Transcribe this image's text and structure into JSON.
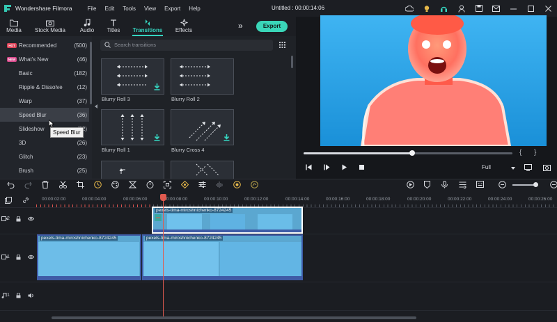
{
  "app": {
    "name": "Wondershare Filmora",
    "menu": [
      "File",
      "Edit",
      "Tools",
      "View",
      "Export",
      "Help"
    ],
    "doc_title": "Untitled : 00:00:14:06",
    "title_icons": [
      "cloud-icon",
      "bulb-icon",
      "headset-icon",
      "account-icon",
      "save-icon",
      "mail-icon",
      "minimize-icon",
      "restore-icon",
      "close-icon"
    ]
  },
  "tabs": [
    {
      "label": "Media",
      "icon": "folder-icon"
    },
    {
      "label": "Stock Media",
      "icon": "camera-icon"
    },
    {
      "label": "Audio",
      "icon": "music-note-icon"
    },
    {
      "label": "Titles",
      "icon": "text-t-icon"
    },
    {
      "label": "Transitions",
      "icon": "transition-icon",
      "active": true
    },
    {
      "label": "Effects",
      "icon": "sparkle-icon"
    }
  ],
  "export_label": "Export",
  "sidebar": {
    "items": [
      {
        "label": "Recommended",
        "count": "(500)",
        "badge": "HOT"
      },
      {
        "label": "What's New",
        "count": "(46)",
        "badge": "NEW"
      },
      {
        "label": "Basic",
        "count": "(182)"
      },
      {
        "label": "Ripple & Dissolve",
        "count": "(12)"
      },
      {
        "label": "Warp",
        "count": "(37)"
      },
      {
        "label": "Speed Blur",
        "count": "(36)",
        "selected": true
      },
      {
        "label": "Slideshow",
        "count": "(22)"
      },
      {
        "label": "3D",
        "count": "(26)"
      },
      {
        "label": "Glitch",
        "count": "(23)"
      },
      {
        "label": "Brush",
        "count": "(25)"
      }
    ],
    "tooltip": "Speed Blur"
  },
  "search": {
    "placeholder": "Search transitions"
  },
  "transitions": [
    {
      "label": "Blurry Roll 3",
      "downloadable": true
    },
    {
      "label": "Blurry Roll 2",
      "downloadable": false
    },
    {
      "label": "Blurry Roll 1",
      "downloadable": true
    },
    {
      "label": "Blurry Cross 4",
      "downloadable": true
    },
    {
      "label": "",
      "downloadable": false
    },
    {
      "label": "",
      "downloadable": false
    }
  ],
  "preview": {
    "progress": 0.52,
    "quality": "Full",
    "controls": [
      "previous-frame-icon",
      "play-pause-icon",
      "play-icon",
      "stop-icon"
    ],
    "right_controls": [
      "monitor-icon",
      "snapshot-icon"
    ]
  },
  "toolbar": {
    "left_tools": [
      "undo-icon",
      "redo-icon",
      "delete-icon",
      "cut-icon",
      "crop-icon",
      "speed-icon",
      "color-icon",
      "duration-icon",
      "stabilize-icon",
      "keyframe-icon",
      "adjust-icon",
      "audio-mix-icon",
      "green-screen-icon",
      "speed-ramp-icon"
    ],
    "right_tools": [
      "render-icon",
      "marker-icon",
      "voiceover-icon",
      "audio-mixer-icon",
      "subtitle-icon",
      "zoom-out-icon",
      "zoom-in-icon"
    ],
    "zoom_level": 0.92
  },
  "timeline": {
    "ruler": [
      "00:00:02:00",
      "00:00:04:00",
      "00:00:06:00",
      "00:00:08:00",
      "00:00:10:00",
      "00:00:12:00",
      "00:00:14:00",
      "00:00:16:00",
      "00:00:18:00",
      "00:00:20:00",
      "00:00:22:00",
      "00:00:24:00",
      "00:00:26:00"
    ],
    "tracks": [
      {
        "id": "2",
        "clips": [
          {
            "name": "pexels-tima-miroshnichenko-8724245",
            "selected": true
          }
        ]
      },
      {
        "id": "1",
        "clips": [
          {
            "name": "pexels-tima-miroshnichenko-8724245"
          },
          {
            "name": "pexels-tima-miroshnichenko-8724245"
          }
        ]
      },
      {
        "id": "1",
        "type": "audio",
        "clips": []
      }
    ]
  },
  "colors": {
    "accent": "#35d5c0",
    "playhead": "#e05a4f",
    "clip_blue": "#5ba7d0",
    "selected_clip_border": "#ffffff"
  }
}
